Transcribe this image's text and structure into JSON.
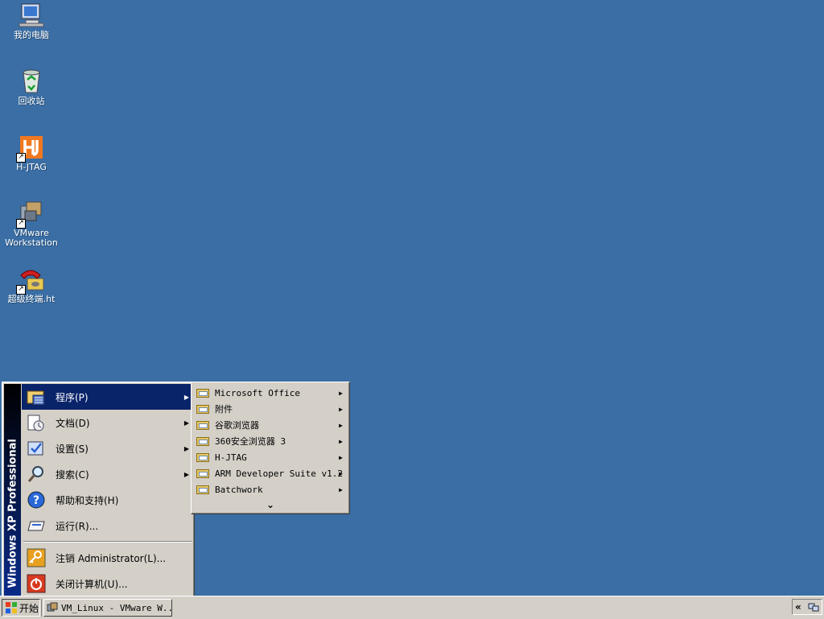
{
  "desktop": {
    "icons": [
      {
        "label": "我的电脑",
        "icon": "my-computer-icon"
      },
      {
        "label": "回收站",
        "icon": "recycle-bin-icon"
      },
      {
        "label": "H-JTAG",
        "icon": "hjtag-icon"
      },
      {
        "label": "VMware Workstation",
        "icon": "vmware-icon"
      },
      {
        "label": "超级终端.ht",
        "icon": "hyperterminal-icon"
      }
    ]
  },
  "start_menu": {
    "banner": "Windows XP Professional",
    "items": [
      {
        "label": "程序(P)",
        "icon": "programs-icon",
        "submenu": true,
        "active": true
      },
      {
        "label": "文档(D)",
        "icon": "documents-icon",
        "submenu": true
      },
      {
        "label": "设置(S)",
        "icon": "settings-icon",
        "submenu": true
      },
      {
        "label": "搜索(C)",
        "icon": "search-icon",
        "submenu": true
      },
      {
        "label": "帮助和支持(H)",
        "icon": "help-icon"
      },
      {
        "label": "运行(R)...",
        "icon": "run-icon"
      },
      {
        "label": "注销 Administrator(L)...",
        "icon": "logoff-icon"
      },
      {
        "label": "关闭计算机(U)...",
        "icon": "shutdown-icon"
      }
    ]
  },
  "programs_submenu": {
    "items": [
      {
        "label": "Microsoft Office"
      },
      {
        "label": "附件"
      },
      {
        "label": "谷歌浏览器"
      },
      {
        "label": "360安全浏览器 3"
      },
      {
        "label": "H-JTAG"
      },
      {
        "label": "ARM Developer Suite v1.2"
      },
      {
        "label": "Batchwork"
      }
    ],
    "more": "⌄"
  },
  "taskbar": {
    "start_label": "开始",
    "task": "VM_Linux - VMware W...",
    "tray_expand": "«"
  },
  "colors": {
    "desktop": "#3a6ea5",
    "highlight": "#0a246a",
    "face": "#d4d0c8"
  }
}
